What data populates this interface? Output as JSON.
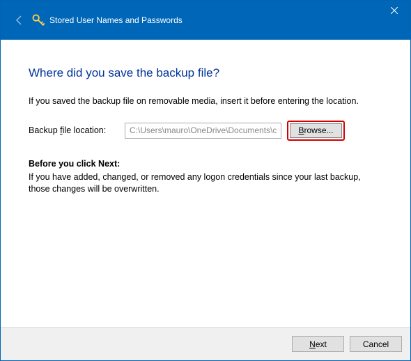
{
  "titlebar": {
    "title": "Stored User Names and Passwords"
  },
  "content": {
    "heading": "Where did you save the backup file?",
    "instructions": "If you saved the backup file on removable media, insert it before entering the location.",
    "location_label_pre": "Backup ",
    "location_label_u": "f",
    "location_label_post": "ile location:",
    "location_value": "C:\\Users\\mauro\\OneDrive\\Documents\\cr",
    "browse_u": "B",
    "browse_rest": "rowse...",
    "sub_heading": "Before you click Next:",
    "sub_text": "If you have added, changed, or removed any logon credentials since your last backup, those changes will be overwritten."
  },
  "footer": {
    "next_u": "N",
    "next_rest": "ext",
    "cancel": "Cancel"
  }
}
